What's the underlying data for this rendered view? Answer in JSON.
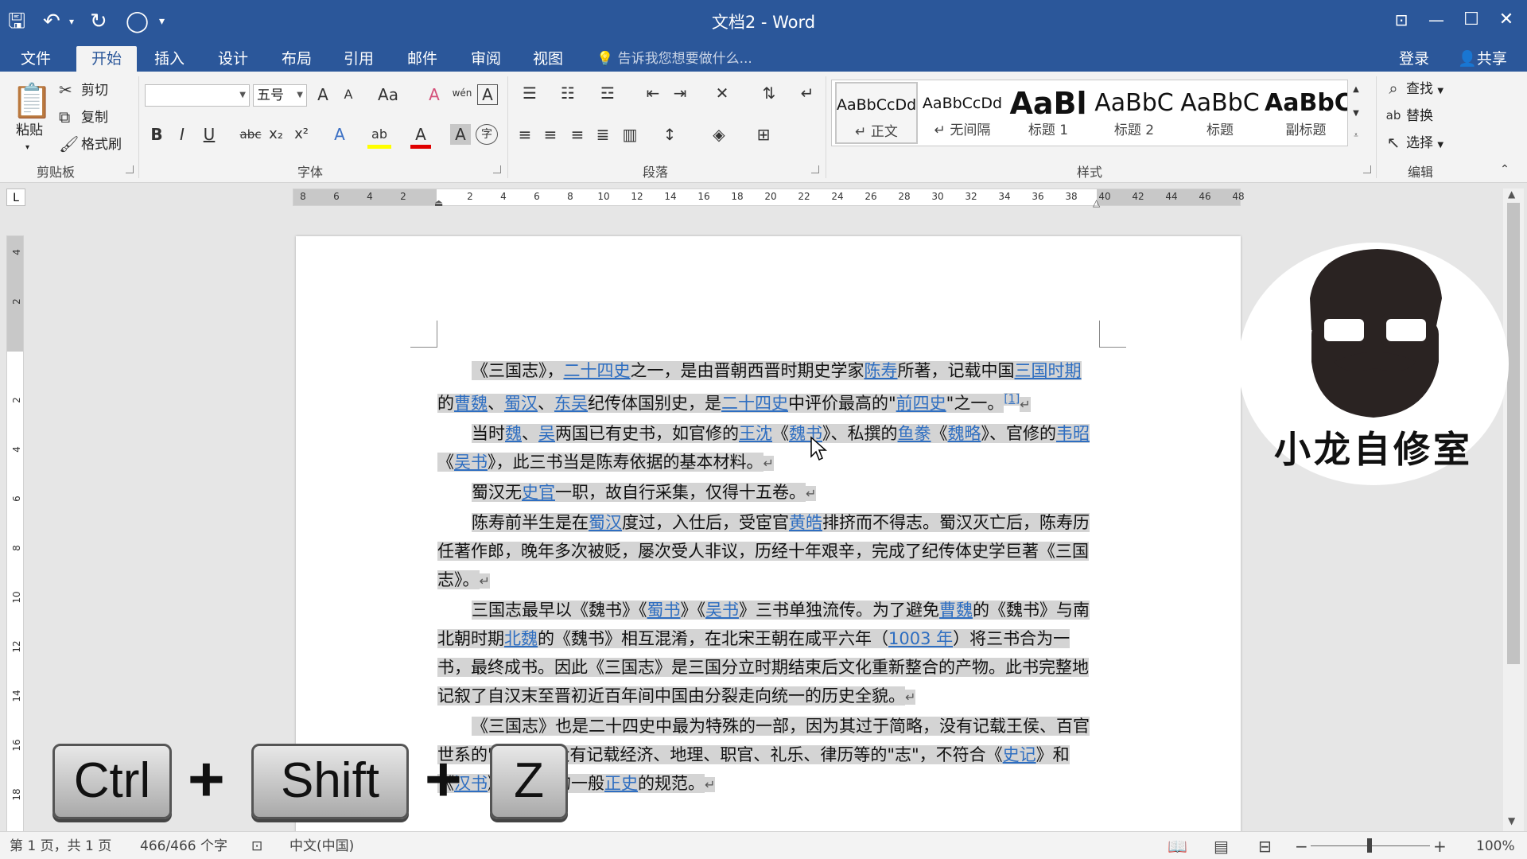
{
  "window": {
    "title": "文档2 - Word",
    "quick_access": {
      "save": "🖫",
      "undo": "↶",
      "redo": "↻",
      "touch": "◯",
      "customize": "▾"
    },
    "controls": {
      "ribbon_display": "⊡",
      "minimize": "—",
      "maximize": "☐",
      "close": "✕"
    }
  },
  "tabs": [
    {
      "label": "文件"
    },
    {
      "label": "开始"
    },
    {
      "label": "插入"
    },
    {
      "label": "设计"
    },
    {
      "label": "布局"
    },
    {
      "label": "引用"
    },
    {
      "label": "邮件"
    },
    {
      "label": "审阅"
    },
    {
      "label": "视图"
    }
  ],
  "tell_me": "告诉我您想要做什么...",
  "account": {
    "login": "登录",
    "share": "共享"
  },
  "ribbon": {
    "clipboard": {
      "paste": "粘贴",
      "cut": "剪切",
      "copy": "复制",
      "format_painter": "格式刷",
      "label": "剪贴板"
    },
    "font": {
      "name_value": "",
      "size_value": "五号",
      "label": "字体",
      "buttons": {
        "bold": "B",
        "italic": "I",
        "underline": "U",
        "strike": "abc",
        "sub": "x₂",
        "sup": "x²",
        "grow": "A",
        "shrink": "A",
        "case": "Aa",
        "pinyin": "wén",
        "border_char": "A",
        "clear": "A",
        "effect": "A",
        "highlight": "ab",
        "color": "A",
        "shade": "A",
        "enclose": "字"
      }
    },
    "paragraph": {
      "label": "段落"
    },
    "styles": {
      "label": "样式",
      "items": [
        {
          "preview": "AaBbCcDd",
          "name": "正文",
          "mark": "↵"
        },
        {
          "preview": "AaBbCcDd",
          "name": "无间隔",
          "mark": "↵"
        },
        {
          "preview": "AaBl",
          "name": "标题 1",
          "mark": ""
        },
        {
          "preview": "AaBbC",
          "name": "标题 2",
          "mark": ""
        },
        {
          "preview": "AaBbC",
          "name": "标题",
          "mark": ""
        },
        {
          "preview": "AaBbC",
          "name": "副标题",
          "mark": ""
        }
      ]
    },
    "editing": {
      "find": "查找",
      "replace": "替换",
      "select": "选择",
      "label": "编辑"
    }
  },
  "ruler": {
    "h_left": [
      "8",
      "6",
      "4",
      "2"
    ],
    "h_right": [
      "2",
      "4",
      "6",
      "8",
      "10",
      "12",
      "14",
      "16",
      "18",
      "20",
      "22",
      "24",
      "26",
      "28",
      "30",
      "32",
      "34",
      "36",
      "38",
      "40",
      "42",
      "44",
      "46",
      "48"
    ],
    "v_top": [
      "4",
      "2"
    ],
    "v_bottom": [
      "2",
      "4",
      "6",
      "8",
      "10",
      "12",
      "14",
      "16",
      "18"
    ],
    "corner": "L"
  },
  "document": {
    "paragraphs": [
      {
        "segments": [
          {
            "t": "《三国志》，"
          },
          {
            "t": "二十四史",
            "link": true
          },
          {
            "t": "之一，是由晋朝西晋时期史学家"
          },
          {
            "t": "陈寿",
            "link": true
          },
          {
            "t": "所著，记载中国"
          },
          {
            "t": "三国时期",
            "link": true
          },
          {
            "t": "的"
          },
          {
            "t": "曹魏",
            "link": true
          },
          {
            "t": "、"
          },
          {
            "t": "蜀汉",
            "link": true
          },
          {
            "t": "、"
          },
          {
            "t": "东吴",
            "link": true
          },
          {
            "t": "纪传体国别史，是"
          },
          {
            "t": "二十四史",
            "link": true
          },
          {
            "t": "中评价最高的\""
          },
          {
            "t": "前四史",
            "link": true
          },
          {
            "t": "\"之一。"
          },
          {
            "t": "[1]",
            "link": true,
            "sup": true
          },
          {
            "t": "↵",
            "mark": true
          }
        ]
      },
      {
        "segments": [
          {
            "t": "当时"
          },
          {
            "t": "魏",
            "link": true
          },
          {
            "t": "、"
          },
          {
            "t": "吴",
            "link": true
          },
          {
            "t": "两国已有史书，如官修的"
          },
          {
            "t": "王沈",
            "link": true
          },
          {
            "t": "《"
          },
          {
            "t": "魏书",
            "link": true
          },
          {
            "t": "》、私撰的"
          },
          {
            "t": "鱼豢",
            "link": true
          },
          {
            "t": "《"
          },
          {
            "t": "魏略",
            "link": true
          },
          {
            "t": "》、官修的"
          },
          {
            "t": "韦昭",
            "link": true
          },
          {
            "t": "《"
          },
          {
            "t": "吴书",
            "link": true
          },
          {
            "t": "》，此三书当是陈寿依据的基本材料。"
          },
          {
            "t": "↵",
            "mark": true
          }
        ]
      },
      {
        "segments": [
          {
            "t": "蜀汉无"
          },
          {
            "t": "史官",
            "link": true
          },
          {
            "t": "一职，故自行采集，仅得十五卷。"
          },
          {
            "t": "↵",
            "mark": true
          }
        ]
      },
      {
        "segments": [
          {
            "t": "陈寿前半生是在"
          },
          {
            "t": "蜀汉",
            "link": true
          },
          {
            "t": "度过，入仕后，受宦官"
          },
          {
            "t": "黄皓",
            "link": true
          },
          {
            "t": "排挤而不得志。蜀汉灭亡后，陈寿历任著作郎，晚年多次被贬，屡次受人非议，历经十年艰辛，完成了纪传体史学巨著《三国志》。"
          },
          {
            "t": "↵",
            "mark": true
          }
        ]
      },
      {
        "segments": [
          {
            "t": "三国志最早以《魏书》《"
          },
          {
            "t": "蜀书",
            "link": true
          },
          {
            "t": "》《"
          },
          {
            "t": "吴书",
            "link": true
          },
          {
            "t": "》三书单独流传。为了避免"
          },
          {
            "t": "曹魏",
            "link": true
          },
          {
            "t": "的《魏书》与南北朝时期"
          },
          {
            "t": "北魏",
            "link": true
          },
          {
            "t": "的《魏书》相互混淆，在北宋王朝在咸平六年（"
          },
          {
            "t": "1003 年",
            "link": true
          },
          {
            "t": "）将三书合为一书，最终成书。因此《三国志》是三国分立时期结束后文化重新整合的产物。此书完整地记叙了自汉末至晋初近百年间中国由分裂走向统一的历史全貌。"
          },
          {
            "t": "↵",
            "mark": true
          }
        ]
      },
      {
        "segments": [
          {
            "t": "《三国志》也是二十四史中最为特殊的一部，因为其过于简略，没有记载王侯、百官世系的\""
          },
          {
            "t": "表",
            "link": true
          },
          {
            "t": "\"，也没有记载经济、地理、职官、礼乐、律历等的\"志\"，不符合《"
          },
          {
            "t": "史记",
            "link": true
          },
          {
            "t": "》和《"
          },
          {
            "t": "汉书",
            "link": true
          },
          {
            "t": "》所确立的一般"
          },
          {
            "t": "正史",
            "link": true
          },
          {
            "t": "的规范。"
          },
          {
            "t": "↵",
            "mark": true
          }
        ]
      }
    ]
  },
  "status": {
    "page": "第 1 页，共 1 页",
    "words": "466/466 个字",
    "language": "中文(中国)",
    "zoom": "100%",
    "zoom_minus": "−",
    "zoom_plus": "+"
  },
  "overlay": {
    "keys": [
      "Ctrl",
      "Shift",
      "Z"
    ],
    "plus": "+",
    "brand": "小龙自修室"
  }
}
